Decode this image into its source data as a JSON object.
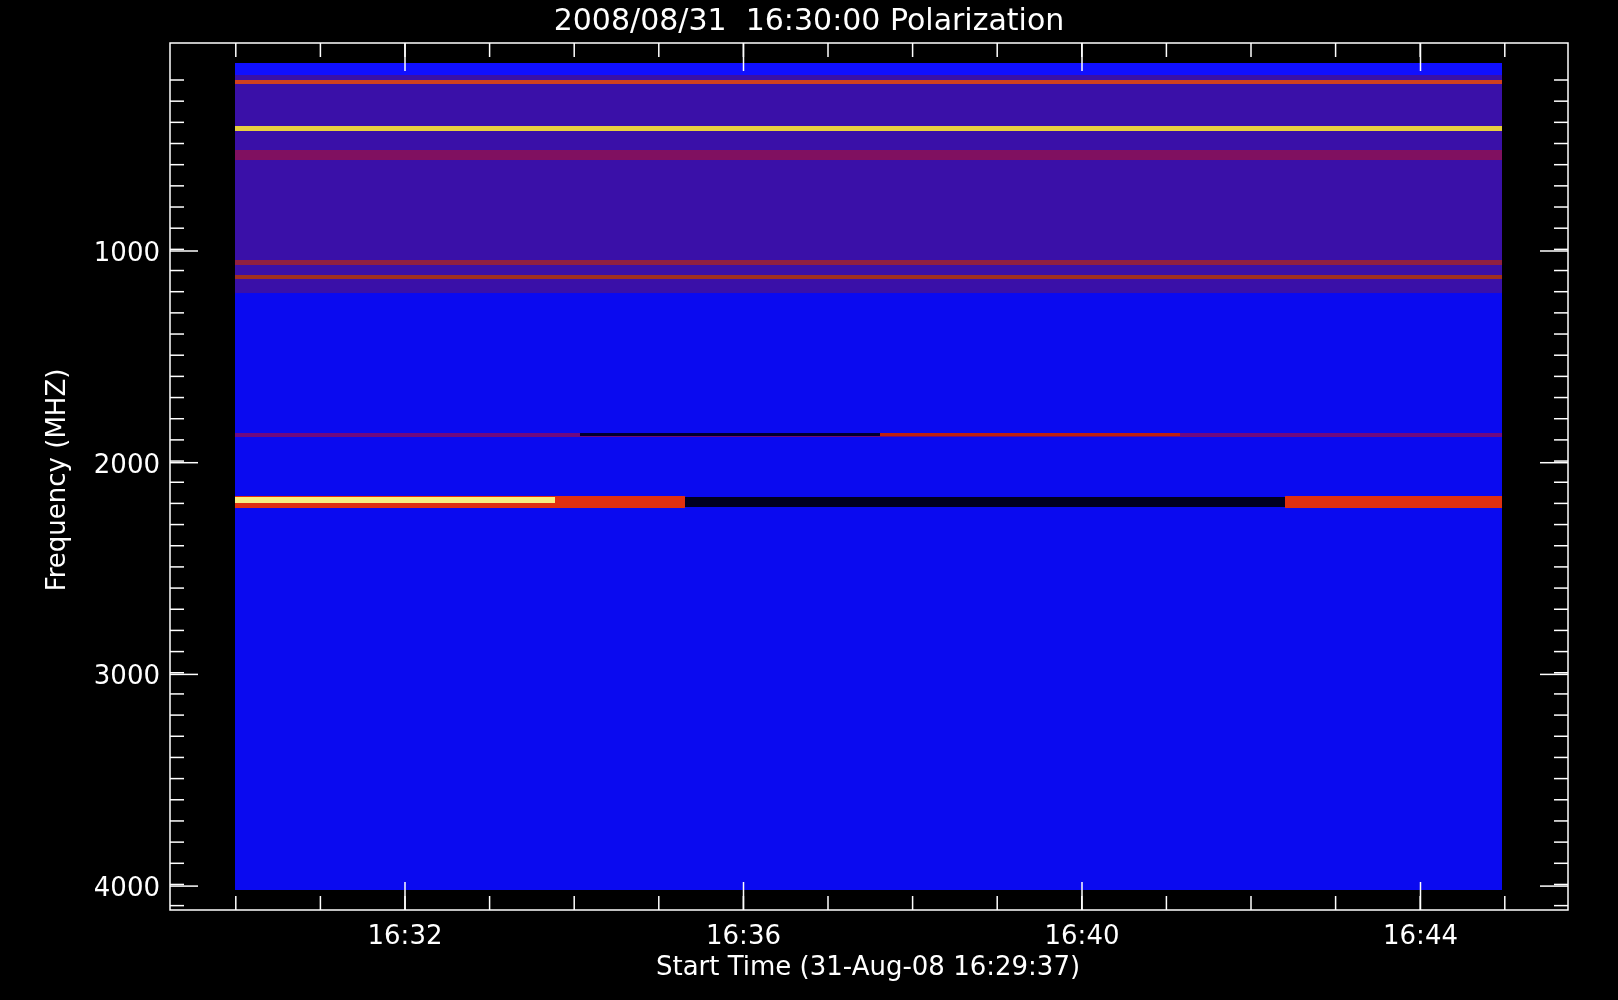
{
  "title": "2008/08/31  16:30:00 Polarization",
  "y_axis": {
    "label": "Frequency (MHZ)",
    "ticks": [
      "1000",
      "2000",
      "3000",
      "4000"
    ]
  },
  "x_axis": {
    "label": "Start Time (31-Aug-08 16:29:37)",
    "ticks": [
      "16:32",
      "16:36",
      "16:40",
      "16:44"
    ]
  }
}
